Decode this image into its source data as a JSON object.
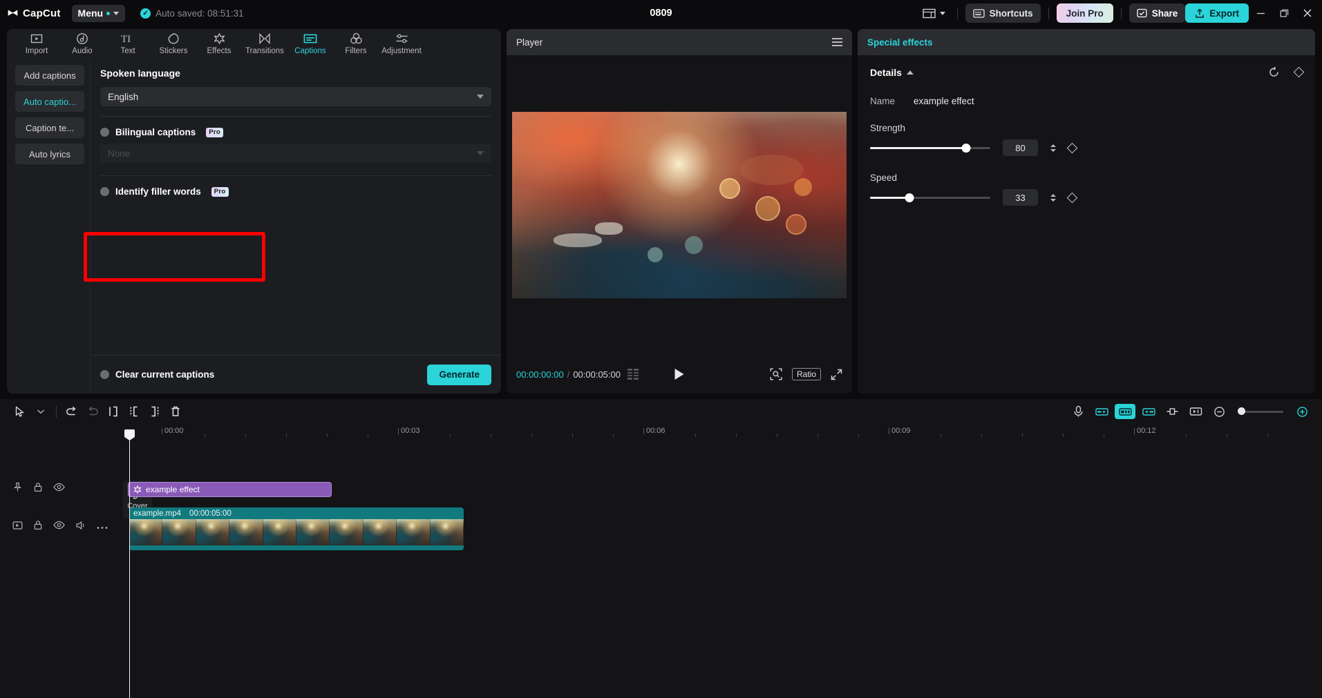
{
  "titlebar": {
    "brand": "CapCut",
    "menu_label": "Menu",
    "autosave": "Auto saved: 08:51:31",
    "project_title": "0809",
    "shortcuts_label": "Shortcuts",
    "join_pro_label": "Join Pro",
    "share_label": "Share",
    "export_label": "Export",
    "minimize_label": "–",
    "maximize_label": "❐",
    "close_label": "✕",
    "accent": "#2ad4d8"
  },
  "nav_tabs": [
    {
      "label": "Import",
      "icon": "import-icon",
      "active": false
    },
    {
      "label": "Audio",
      "icon": "audio-icon",
      "active": false
    },
    {
      "label": "Text",
      "icon": "text-icon",
      "active": false
    },
    {
      "label": "Stickers",
      "icon": "stickers-icon",
      "active": false
    },
    {
      "label": "Effects",
      "icon": "effects-icon",
      "active": false
    },
    {
      "label": "Transitions",
      "icon": "transitions-icon",
      "active": false
    },
    {
      "label": "Captions",
      "icon": "captions-icon",
      "active": true
    },
    {
      "label": "Filters",
      "icon": "filters-icon",
      "active": false
    },
    {
      "label": "Adjustment",
      "icon": "adjustment-icon",
      "active": false
    }
  ],
  "side_list": [
    {
      "label": "Add captions",
      "active": false
    },
    {
      "label": "Auto captio...",
      "active": true
    },
    {
      "label": "Caption te...",
      "active": false
    },
    {
      "label": "Auto lyrics",
      "active": false
    }
  ],
  "captions": {
    "spoken_language_label": "Spoken language",
    "language_value": "English",
    "bilingual_label": "Bilingual captions",
    "bilingual_pro": "Pro",
    "bilingual_select_placeholder": "None",
    "filler_label": "Identify filler words",
    "filler_pro": "Pro",
    "clear_label": "Clear current captions",
    "generate_label": "Generate",
    "highlight_color": "#fe0000"
  },
  "player": {
    "title": "Player",
    "current_time": "00:00:00:00",
    "time_separator": "/",
    "total_time": "00:00:05:00",
    "ratio_label": "Ratio",
    "play_icon": "play-icon",
    "fullscreen_icon": "fullscreen-icon",
    "zoom_icon": "zoom-fit-icon",
    "grid_icon": "grid-icon",
    "menu_icon": "hamburger-icon"
  },
  "right_panel": {
    "title": "Special effects",
    "details_label": "Details",
    "name_label": "Name",
    "name_value": "example effect",
    "strength_label": "Strength",
    "strength_value": "80",
    "speed_label": "Speed",
    "speed_value": "33",
    "reset_icon": "reset-icon",
    "keyframe_icon": "keyframe-diamond-icon"
  },
  "timeline": {
    "toolbar_left": [
      "select-arrow-icon",
      "dropdown-chevron-icon",
      "undo-icon",
      "redo-icon",
      "split-icon",
      "trim-left-icon",
      "trim-right-icon",
      "delete-icon"
    ],
    "toolbar_right": [
      "microphone-icon",
      "mirror-left-icon",
      "auto-edit-icon",
      "mirror-right-icon",
      "crop-icon",
      "freeze-icon"
    ],
    "ruler_labels": [
      "00:00",
      "00:03",
      "00:06",
      "00:09",
      "00:12"
    ],
    "cover_label": "Cover",
    "effect_clip": {
      "label": "example effect",
      "icon": "effect-icon"
    },
    "video_clip": {
      "name": "example.mp4",
      "duration": "00:00:05:00"
    },
    "zoom_out_icon": "zoom-out-icon",
    "zoom_in_icon": "zoom-in-icon"
  }
}
